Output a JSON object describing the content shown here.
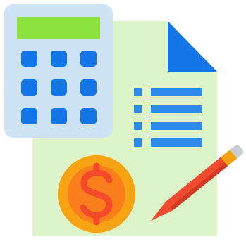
{
  "illustration": {
    "icons": [
      "document-icon",
      "calculator-icon",
      "checklist-icon",
      "dollar-coin-icon",
      "pencil-icon"
    ],
    "calculator": {
      "display": "",
      "keys": 9
    },
    "checklist": {
      "rows": 4
    },
    "coin": {
      "symbol": "$"
    }
  },
  "colors": {
    "paper": "#DDF4C8",
    "paper_fold": "#1476E6",
    "calculator_body": "#CFE3F6",
    "calculator_display": "#8CE23B",
    "calculator_keys": "#1476E6",
    "checklist": "#2C8BEA",
    "coin_outer": "#F8A313",
    "coin_inner": "#FA7E1B",
    "coin_symbol": "#F24B2A",
    "pencil_body": "#F14A2E",
    "pencil_tip": "#F2A30F",
    "pencil_eraser": "#C9CCD1"
  }
}
